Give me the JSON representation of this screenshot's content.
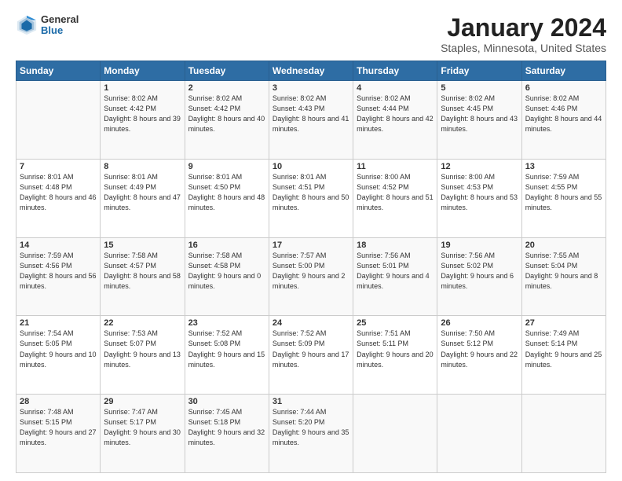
{
  "header": {
    "logo_general": "General",
    "logo_blue": "Blue",
    "main_title": "January 2024",
    "subtitle": "Staples, Minnesota, United States"
  },
  "calendar": {
    "days_of_week": [
      "Sunday",
      "Monday",
      "Tuesday",
      "Wednesday",
      "Thursday",
      "Friday",
      "Saturday"
    ],
    "weeks": [
      [
        {
          "day": "",
          "sunrise": "",
          "sunset": "",
          "daylight": ""
        },
        {
          "day": "1",
          "sunrise": "Sunrise: 8:02 AM",
          "sunset": "Sunset: 4:42 PM",
          "daylight": "Daylight: 8 hours and 39 minutes."
        },
        {
          "day": "2",
          "sunrise": "Sunrise: 8:02 AM",
          "sunset": "Sunset: 4:42 PM",
          "daylight": "Daylight: 8 hours and 40 minutes."
        },
        {
          "day": "3",
          "sunrise": "Sunrise: 8:02 AM",
          "sunset": "Sunset: 4:43 PM",
          "daylight": "Daylight: 8 hours and 41 minutes."
        },
        {
          "day": "4",
          "sunrise": "Sunrise: 8:02 AM",
          "sunset": "Sunset: 4:44 PM",
          "daylight": "Daylight: 8 hours and 42 minutes."
        },
        {
          "day": "5",
          "sunrise": "Sunrise: 8:02 AM",
          "sunset": "Sunset: 4:45 PM",
          "daylight": "Daylight: 8 hours and 43 minutes."
        },
        {
          "day": "6",
          "sunrise": "Sunrise: 8:02 AM",
          "sunset": "Sunset: 4:46 PM",
          "daylight": "Daylight: 8 hours and 44 minutes."
        }
      ],
      [
        {
          "day": "7",
          "sunrise": "Sunrise: 8:01 AM",
          "sunset": "Sunset: 4:48 PM",
          "daylight": "Daylight: 8 hours and 46 minutes."
        },
        {
          "day": "8",
          "sunrise": "Sunrise: 8:01 AM",
          "sunset": "Sunset: 4:49 PM",
          "daylight": "Daylight: 8 hours and 47 minutes."
        },
        {
          "day": "9",
          "sunrise": "Sunrise: 8:01 AM",
          "sunset": "Sunset: 4:50 PM",
          "daylight": "Daylight: 8 hours and 48 minutes."
        },
        {
          "day": "10",
          "sunrise": "Sunrise: 8:01 AM",
          "sunset": "Sunset: 4:51 PM",
          "daylight": "Daylight: 8 hours and 50 minutes."
        },
        {
          "day": "11",
          "sunrise": "Sunrise: 8:00 AM",
          "sunset": "Sunset: 4:52 PM",
          "daylight": "Daylight: 8 hours and 51 minutes."
        },
        {
          "day": "12",
          "sunrise": "Sunrise: 8:00 AM",
          "sunset": "Sunset: 4:53 PM",
          "daylight": "Daylight: 8 hours and 53 minutes."
        },
        {
          "day": "13",
          "sunrise": "Sunrise: 7:59 AM",
          "sunset": "Sunset: 4:55 PM",
          "daylight": "Daylight: 8 hours and 55 minutes."
        }
      ],
      [
        {
          "day": "14",
          "sunrise": "Sunrise: 7:59 AM",
          "sunset": "Sunset: 4:56 PM",
          "daylight": "Daylight: 8 hours and 56 minutes."
        },
        {
          "day": "15",
          "sunrise": "Sunrise: 7:58 AM",
          "sunset": "Sunset: 4:57 PM",
          "daylight": "Daylight: 8 hours and 58 minutes."
        },
        {
          "day": "16",
          "sunrise": "Sunrise: 7:58 AM",
          "sunset": "Sunset: 4:58 PM",
          "daylight": "Daylight: 9 hours and 0 minutes."
        },
        {
          "day": "17",
          "sunrise": "Sunrise: 7:57 AM",
          "sunset": "Sunset: 5:00 PM",
          "daylight": "Daylight: 9 hours and 2 minutes."
        },
        {
          "day": "18",
          "sunrise": "Sunrise: 7:56 AM",
          "sunset": "Sunset: 5:01 PM",
          "daylight": "Daylight: 9 hours and 4 minutes."
        },
        {
          "day": "19",
          "sunrise": "Sunrise: 7:56 AM",
          "sunset": "Sunset: 5:02 PM",
          "daylight": "Daylight: 9 hours and 6 minutes."
        },
        {
          "day": "20",
          "sunrise": "Sunrise: 7:55 AM",
          "sunset": "Sunset: 5:04 PM",
          "daylight": "Daylight: 9 hours and 8 minutes."
        }
      ],
      [
        {
          "day": "21",
          "sunrise": "Sunrise: 7:54 AM",
          "sunset": "Sunset: 5:05 PM",
          "daylight": "Daylight: 9 hours and 10 minutes."
        },
        {
          "day": "22",
          "sunrise": "Sunrise: 7:53 AM",
          "sunset": "Sunset: 5:07 PM",
          "daylight": "Daylight: 9 hours and 13 minutes."
        },
        {
          "day": "23",
          "sunrise": "Sunrise: 7:52 AM",
          "sunset": "Sunset: 5:08 PM",
          "daylight": "Daylight: 9 hours and 15 minutes."
        },
        {
          "day": "24",
          "sunrise": "Sunrise: 7:52 AM",
          "sunset": "Sunset: 5:09 PM",
          "daylight": "Daylight: 9 hours and 17 minutes."
        },
        {
          "day": "25",
          "sunrise": "Sunrise: 7:51 AM",
          "sunset": "Sunset: 5:11 PM",
          "daylight": "Daylight: 9 hours and 20 minutes."
        },
        {
          "day": "26",
          "sunrise": "Sunrise: 7:50 AM",
          "sunset": "Sunset: 5:12 PM",
          "daylight": "Daylight: 9 hours and 22 minutes."
        },
        {
          "day": "27",
          "sunrise": "Sunrise: 7:49 AM",
          "sunset": "Sunset: 5:14 PM",
          "daylight": "Daylight: 9 hours and 25 minutes."
        }
      ],
      [
        {
          "day": "28",
          "sunrise": "Sunrise: 7:48 AM",
          "sunset": "Sunset: 5:15 PM",
          "daylight": "Daylight: 9 hours and 27 minutes."
        },
        {
          "day": "29",
          "sunrise": "Sunrise: 7:47 AM",
          "sunset": "Sunset: 5:17 PM",
          "daylight": "Daylight: 9 hours and 30 minutes."
        },
        {
          "day": "30",
          "sunrise": "Sunrise: 7:45 AM",
          "sunset": "Sunset: 5:18 PM",
          "daylight": "Daylight: 9 hours and 32 minutes."
        },
        {
          "day": "31",
          "sunrise": "Sunrise: 7:44 AM",
          "sunset": "Sunset: 5:20 PM",
          "daylight": "Daylight: 9 hours and 35 minutes."
        },
        {
          "day": "",
          "sunrise": "",
          "sunset": "",
          "daylight": ""
        },
        {
          "day": "",
          "sunrise": "",
          "sunset": "",
          "daylight": ""
        },
        {
          "day": "",
          "sunrise": "",
          "sunset": "",
          "daylight": ""
        }
      ]
    ]
  }
}
